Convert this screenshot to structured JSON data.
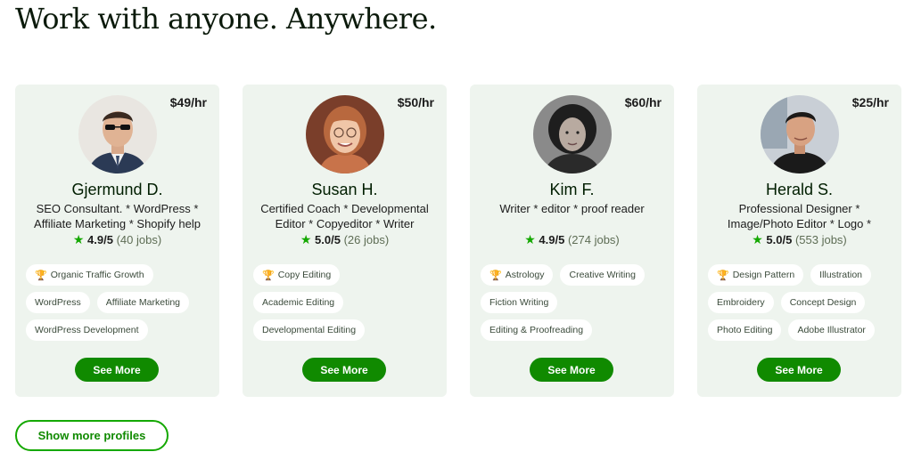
{
  "headline": "Work with anyone. Anywhere.",
  "cards": [
    {
      "rate": "$49/hr",
      "name": "Gjermund D.",
      "title": "SEO Consultant. * WordPress * Affiliate Marketing * Shopify help",
      "score": "4.9/5",
      "jobs": "(40 jobs)",
      "skills": [
        [
          "Organic Traffic Growth"
        ],
        [
          "WordPress",
          "Affiliate Marketing"
        ],
        [
          "WordPress Development"
        ]
      ],
      "button": "See More"
    },
    {
      "rate": "$50/hr",
      "name": "Susan H.",
      "title": "Certified Coach * Developmental Editor * Copyeditor * Writer",
      "score": "5.0/5",
      "jobs": "(26 jobs)",
      "skills": [
        [
          "Copy Editing"
        ],
        [
          "Academic Editing"
        ],
        [
          "Developmental Editing"
        ]
      ],
      "button": "See More"
    },
    {
      "rate": "$60/hr",
      "name": "Kim F.",
      "title": "Writer * editor * proof reader",
      "score": "4.9/5",
      "jobs": "(274 jobs)",
      "skills": [
        [
          "Astrology",
          "Creative Writing"
        ],
        [
          "Fiction Writing"
        ],
        [
          "Editing & Proofreading"
        ]
      ],
      "button": "See More"
    },
    {
      "rate": "$25/hr",
      "name": "Herald S.",
      "title": "Professional Designer * Image/Photo Editor * Logo *",
      "score": "5.0/5",
      "jobs": "(553 jobs)",
      "skills": [
        [
          "Design Pattern",
          "Illustration"
        ],
        [
          "Embroidery",
          "Concept Design"
        ],
        [
          "Photo Editing",
          "Adobe Illustrator"
        ]
      ],
      "button": "See More"
    }
  ],
  "show_more": "Show more profiles",
  "colors": {
    "brand_green": "#108a00",
    "star_green": "#14a800",
    "card_bg": "#eef4ee"
  },
  "icons": {
    "star": "star-icon",
    "trophy": "trophy-icon"
  }
}
